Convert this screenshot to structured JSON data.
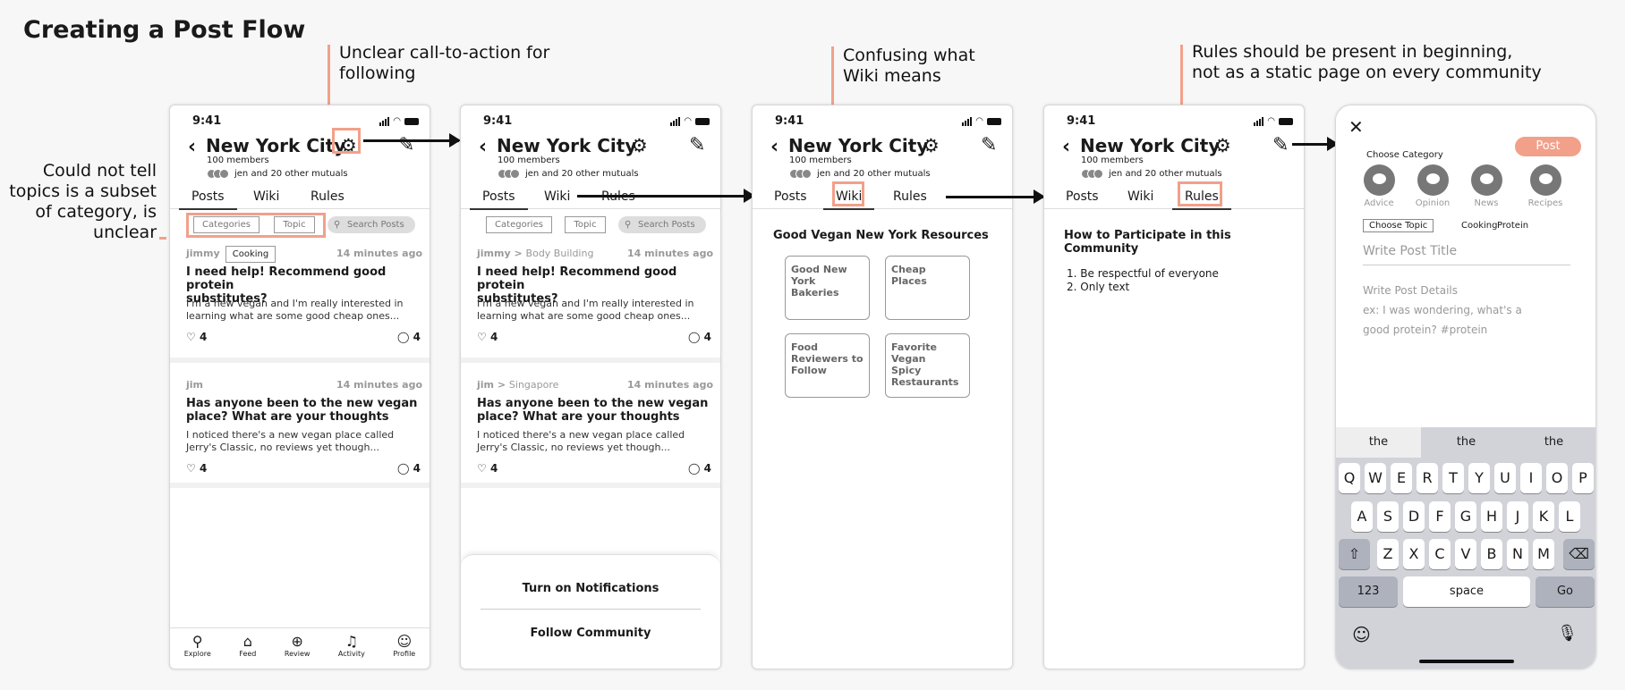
{
  "heading": "Creating a Post Flow",
  "notes": {
    "topics_l1": "Could not tell",
    "topics_l2": "topics is a subset",
    "topics_l3": "of category, is",
    "topics_l4": "unclear",
    "follow_l1": "Unclear call-to-action for",
    "follow_l2": "following",
    "wiki_l1": "Confusing what",
    "wiki_l2": "Wiki means",
    "rules_l1": "Rules should be present in beginning,",
    "rules_l2": "not as a static page on every community"
  },
  "common": {
    "time": "9:41",
    "title": "New York City",
    "members": "100 members",
    "mutuals": "jen and 20 other mutuals",
    "tab_posts": "Posts",
    "tab_wiki": "Wiki",
    "tab_rules": "Rules",
    "chip_categories": "Categories",
    "chip_topic": "Topic",
    "search": "Search Posts",
    "back_glyph": "‹",
    "gear_glyph": "⚙",
    "edit_glyph": "✎",
    "like_count": "4",
    "comment_count": "4"
  },
  "posts": [
    {
      "author": "jimmy",
      "tag": "Cooking",
      "author2": "jimmy",
      "sep2": ">",
      "tag2": "Body Building",
      "time": "14 minutes ago",
      "title_l1": "I need help! Recommend good protein",
      "title_l2": "substitutes?",
      "body_l1": "I'm a new vegan and I'm really interested in",
      "body_l2": "learning what are some good cheap ones..."
    },
    {
      "author": "jim",
      "author2": "jim",
      "sep2": ">",
      "tag2": "Singapore",
      "time": "14 minutes ago",
      "title_l1": "Has anyone been to the new vegan",
      "title_l2": "place? What are your thoughts",
      "body_l1": "I noticed there's a new vegan place called",
      "body_l2": "Jerry's Classic, no reviews yet though..."
    }
  ],
  "nav": {
    "explore": "Explore",
    "feed": "Feed",
    "review": "Review",
    "activity": "Activity",
    "profile": "Profile"
  },
  "sheet": {
    "notifications": "Turn on Notifications",
    "follow": "Follow Community"
  },
  "wiki": {
    "heading": "Good Vegan New York Resources",
    "card1_l1": "Good New",
    "card1_l2": "York Bakeries",
    "card2_l1": "Cheap Places",
    "card3_l1": "Food",
    "card3_l2": "Reviewers to",
    "card3_l3": "Follow",
    "card4_l1": "Favorite Vegan",
    "card4_l2": "Spicy",
    "card4_l3": "Restaurants"
  },
  "rules": {
    "heading": "How to Participate in this Community",
    "rule1": "1. Be respectful of everyone",
    "rule2": "2. Only text"
  },
  "compose": {
    "close": "✕",
    "post_button": "Post",
    "choose_category": "Choose Category",
    "cat_advice": "Advice",
    "cat_opinion": "Opinion",
    "cat_news": "News",
    "cat_recipes": "Recipes",
    "choose_topic": "Choose Topic",
    "topic_cooking": "Cooking",
    "topic_protein": "Protein",
    "title_placeholder": "Write Post Title",
    "details_l1": "Write Post Details",
    "details_l2": "ex: I was wondering, what's a",
    "details_l3": "good protein? #protein",
    "suggestion": "the",
    "row1": [
      "Q",
      "W",
      "E",
      "R",
      "T",
      "Y",
      "U",
      "I",
      "O",
      "P"
    ],
    "row2": [
      "A",
      "S",
      "D",
      "F",
      "G",
      "H",
      "J",
      "K",
      "L"
    ],
    "row3": [
      "Z",
      "X",
      "C",
      "V",
      "B",
      "N",
      "M"
    ],
    "key_123": "123",
    "key_space": "space",
    "key_go": "Go"
  },
  "colors": {
    "accent": "#f2a08a"
  }
}
